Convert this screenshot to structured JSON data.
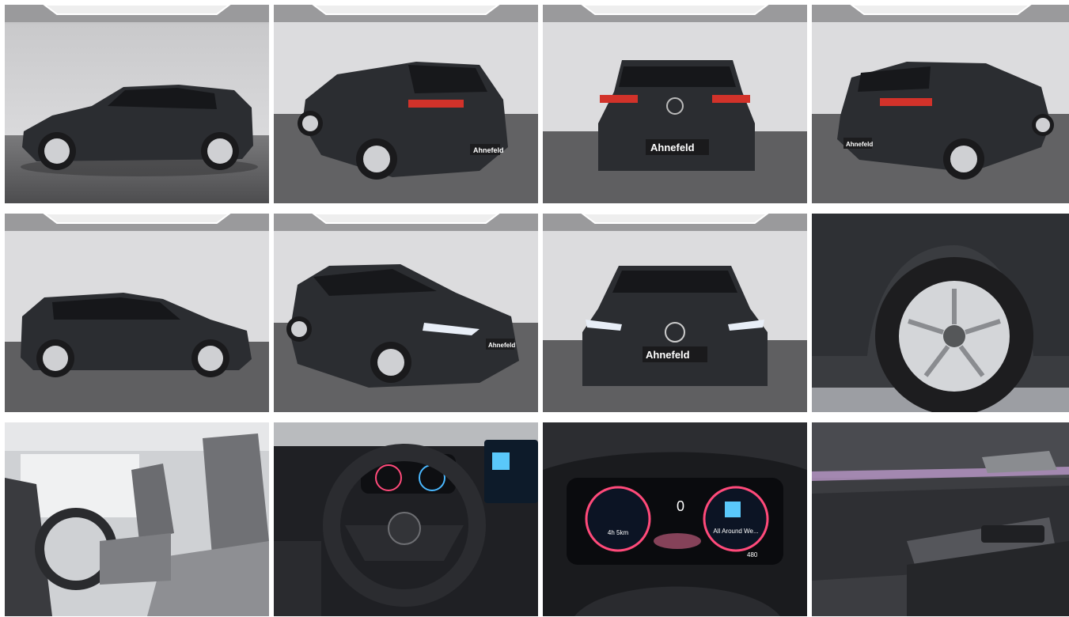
{
  "gallery": {
    "photos": [
      {
        "id": "side-left"
      },
      {
        "id": "rear-left-quarter"
      },
      {
        "id": "rear"
      },
      {
        "id": "rear-right-quarter"
      },
      {
        "id": "side-left-2"
      },
      {
        "id": "front-left-quarter"
      },
      {
        "id": "front"
      },
      {
        "id": "wheel-closeup"
      },
      {
        "id": "front-seats"
      },
      {
        "id": "steering-wheel"
      },
      {
        "id": "instrument-cluster"
      },
      {
        "id": "door-panel"
      }
    ],
    "dealer_plate_text": "Ahnefeld",
    "cluster": {
      "speed": "0",
      "left_gauge_text": "4h 5km",
      "right_gauge_text": "All Around We...",
      "range": "480"
    }
  },
  "colors": {
    "car_paint": "#2b2d31",
    "studio_wall": "#d9d9db",
    "studio_floor": "#5f5f61",
    "tail_light": "#d2322a",
    "cluster_accent": "#ff4a7a"
  }
}
